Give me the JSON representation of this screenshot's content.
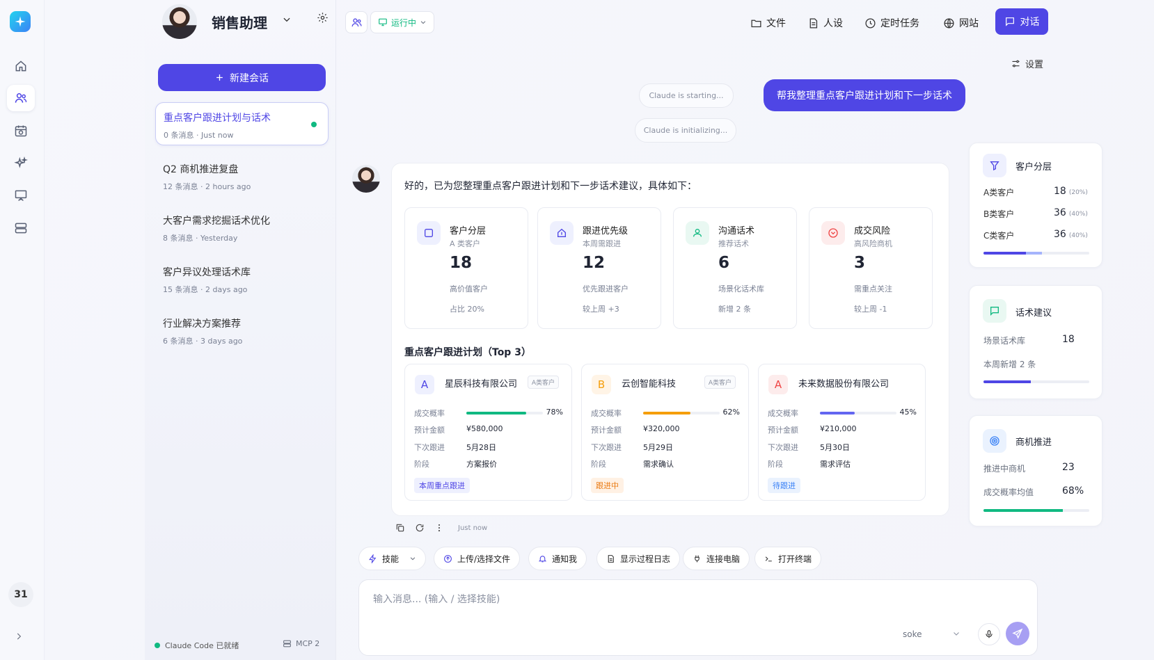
{
  "header": {
    "assistant_name": "销售助理",
    "status": "运行中"
  },
  "topnav": [
    {
      "label": "文件",
      "icon": "folder-icon"
    },
    {
      "label": "人设",
      "icon": "document-icon"
    },
    {
      "label": "定时任务",
      "icon": "clock-icon"
    },
    {
      "label": "网站",
      "icon": "globe-icon"
    }
  ],
  "chat_button": "对话",
  "settings_label": "设置",
  "rail": {
    "day_badge": "31"
  },
  "sidebar": {
    "new_chat": "新建会话",
    "conversations": [
      {
        "title": "重点客户跟进计划与话术",
        "count": "0 条消息",
        "time": "Just now"
      },
      {
        "title": "Q2 商机推进复盘",
        "count": "12 条消息",
        "time": "2 hours ago"
      },
      {
        "title": "大客户需求挖掘话术优化",
        "count": "8 条消息",
        "time": "Yesterday"
      },
      {
        "title": "客户异议处理话术库",
        "count": "15 条消息",
        "time": "2 days ago"
      },
      {
        "title": "行业解决方案推荐",
        "count": "6 条消息",
        "time": "3 days ago"
      }
    ],
    "footer_status": "Claude Code 已就绪",
    "mcp": "MCP 2"
  },
  "chat": {
    "status_pills": [
      "Claude is starting...",
      "Claude is initializing..."
    ],
    "user_message": "帮我整理重点客户跟进计划和下一步话术",
    "intro": "好的，已为您整理重点客户跟进计划和下一步话术建议，具体如下：",
    "stats": [
      {
        "title": "客户分层",
        "sub": "A 类客户",
        "value": "18",
        "desc": "高价值客户",
        "foot": "占比 20%",
        "icon": "square-icon",
        "color": "#4f46e5"
      },
      {
        "title": "跟进优先级",
        "sub": "本周需跟进",
        "value": "12",
        "desc": "优先跟进客户",
        "foot": "较上周 +3",
        "icon": "upload-box-icon",
        "color": "#4f46e5"
      },
      {
        "title": "沟通话术",
        "sub": "推荐话术",
        "value": "6",
        "desc": "场景化话术库",
        "foot": "新增 2 条",
        "icon": "user-check-icon",
        "color": "#10b981"
      },
      {
        "title": "成交风险",
        "sub": "高风险商机",
        "value": "3",
        "desc": "需重点关注",
        "foot": "较上周 -1",
        "icon": "alert-heart-icon",
        "color": "#ef4444"
      }
    ],
    "section_title": "重点客户跟进计划（Top 3）",
    "row_labels": {
      "probability": "成交概率",
      "amount": "预计金额",
      "next": "下次跟进",
      "stage": "阶段"
    },
    "customers": [
      {
        "letter": "A",
        "name": "星辰科技有限公司",
        "tag": "A类客户",
        "probability": 0.78,
        "probability_text": "78%",
        "amount": "¥580,000",
        "next": "5月28日",
        "stage": "方案报价",
        "badge": "本周重点跟进",
        "color": "#10b981",
        "letter_color": "#4f46e5",
        "letter_bg": "#eef0fe",
        "badge_color": "#4f46e5",
        "badge_bg": "#eef0fe"
      },
      {
        "letter": "B",
        "name": "云创智能科技",
        "tag": "A类客户",
        "probability": 0.62,
        "probability_text": "62%",
        "amount": "¥320,000",
        "next": "5月29日",
        "stage": "需求确认",
        "badge": "跟进中",
        "color": "#f59e0b",
        "letter_color": "#f59e0b",
        "letter_bg": "#fff4e6",
        "badge_color": "#ea7a12",
        "badge_bg": "#fff1e4"
      },
      {
        "letter": "A",
        "name": "未来数据股份有限公司",
        "tag": "",
        "probability": 0.45,
        "probability_text": "45%",
        "amount": "¥210,000",
        "next": "5月30日",
        "stage": "需求评估",
        "badge": "待跟进",
        "color": "#6366f1",
        "letter_color": "#ef4444",
        "letter_bg": "#fdecec",
        "badge_color": "#3b82f6",
        "badge_bg": "#eaf2fe"
      }
    ],
    "timestamp": "Just now"
  },
  "toolbar": [
    "技能",
    "上传/选择文件",
    "通知我",
    "显示过程日志",
    "连接电脑",
    "打开终端"
  ],
  "composer": {
    "placeholder": "输入消息... (输入 / 选择技能)",
    "model": "soke"
  },
  "right_panel": {
    "segmentation": {
      "title": "客户分层",
      "rows": [
        {
          "label": "A类客户",
          "value": "18",
          "pct": "(20%)"
        },
        {
          "label": "B类客户",
          "value": "36",
          "pct": "(40%)"
        },
        {
          "label": "C类客户",
          "value": "36",
          "pct": "(40%)"
        }
      ]
    },
    "talk": {
      "title": "话术建议",
      "label1": "场景话术库",
      "value1": "18",
      "label2": "本周新增 2 条",
      "progress": 0.45
    },
    "opportunity": {
      "title": "商机推进",
      "label1": "推进中商机",
      "value1": "23",
      "label2": "成交概率均值",
      "value2": "68%",
      "progress": 0.75
    }
  }
}
